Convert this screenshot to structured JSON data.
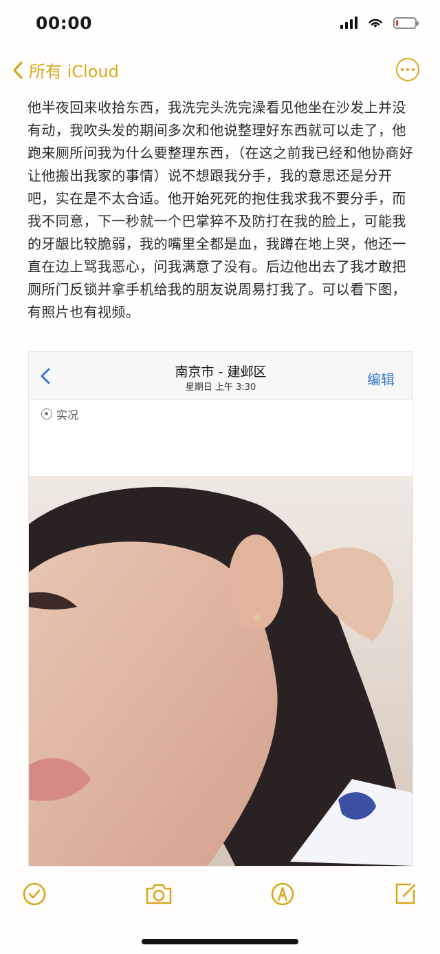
{
  "status_bar": {
    "time": "00:00",
    "battery_level_percent": 10
  },
  "nav": {
    "back_label": "所有 iCloud",
    "more_icon": "ellipsis-circle-icon",
    "accent": "#d9a61b"
  },
  "note": {
    "body": "他半夜回来收拾东西，我洗完头洗完澡看见他坐在沙发上并没有动，我吹头发的期间多次和他说整理好东西就可以走了，他跑来厕所问我为什么要整理东西，（在这之前我已经和他协商好让他搬出我家的事情）说不想跟我分手，我的意思还是分开吧，实在是不太合适。他开始死死的抱住我求我不要分手，而我不同意，下一秒就一个巴掌猝不及防打在我的脸上，可能我的牙龈比较脆弱，我的嘴里全都是血，我蹲在地上哭，他还一直在边上骂我恶心，问我满意了没有。后边他出去了我才敢把厕所门反锁并拿手机给我的朋友说周易打我了。可以看下图，有照片也有视频。"
  },
  "photo": {
    "location": "南京市 - 建邺区",
    "datetime": "星期日 上午 3:30",
    "edit_label": "编辑",
    "live_label": "实况",
    "link_color": "#3478c8"
  },
  "toolbar": {
    "items": [
      "checklist-icon",
      "camera-icon",
      "markup-icon",
      "compose-icon"
    ]
  }
}
